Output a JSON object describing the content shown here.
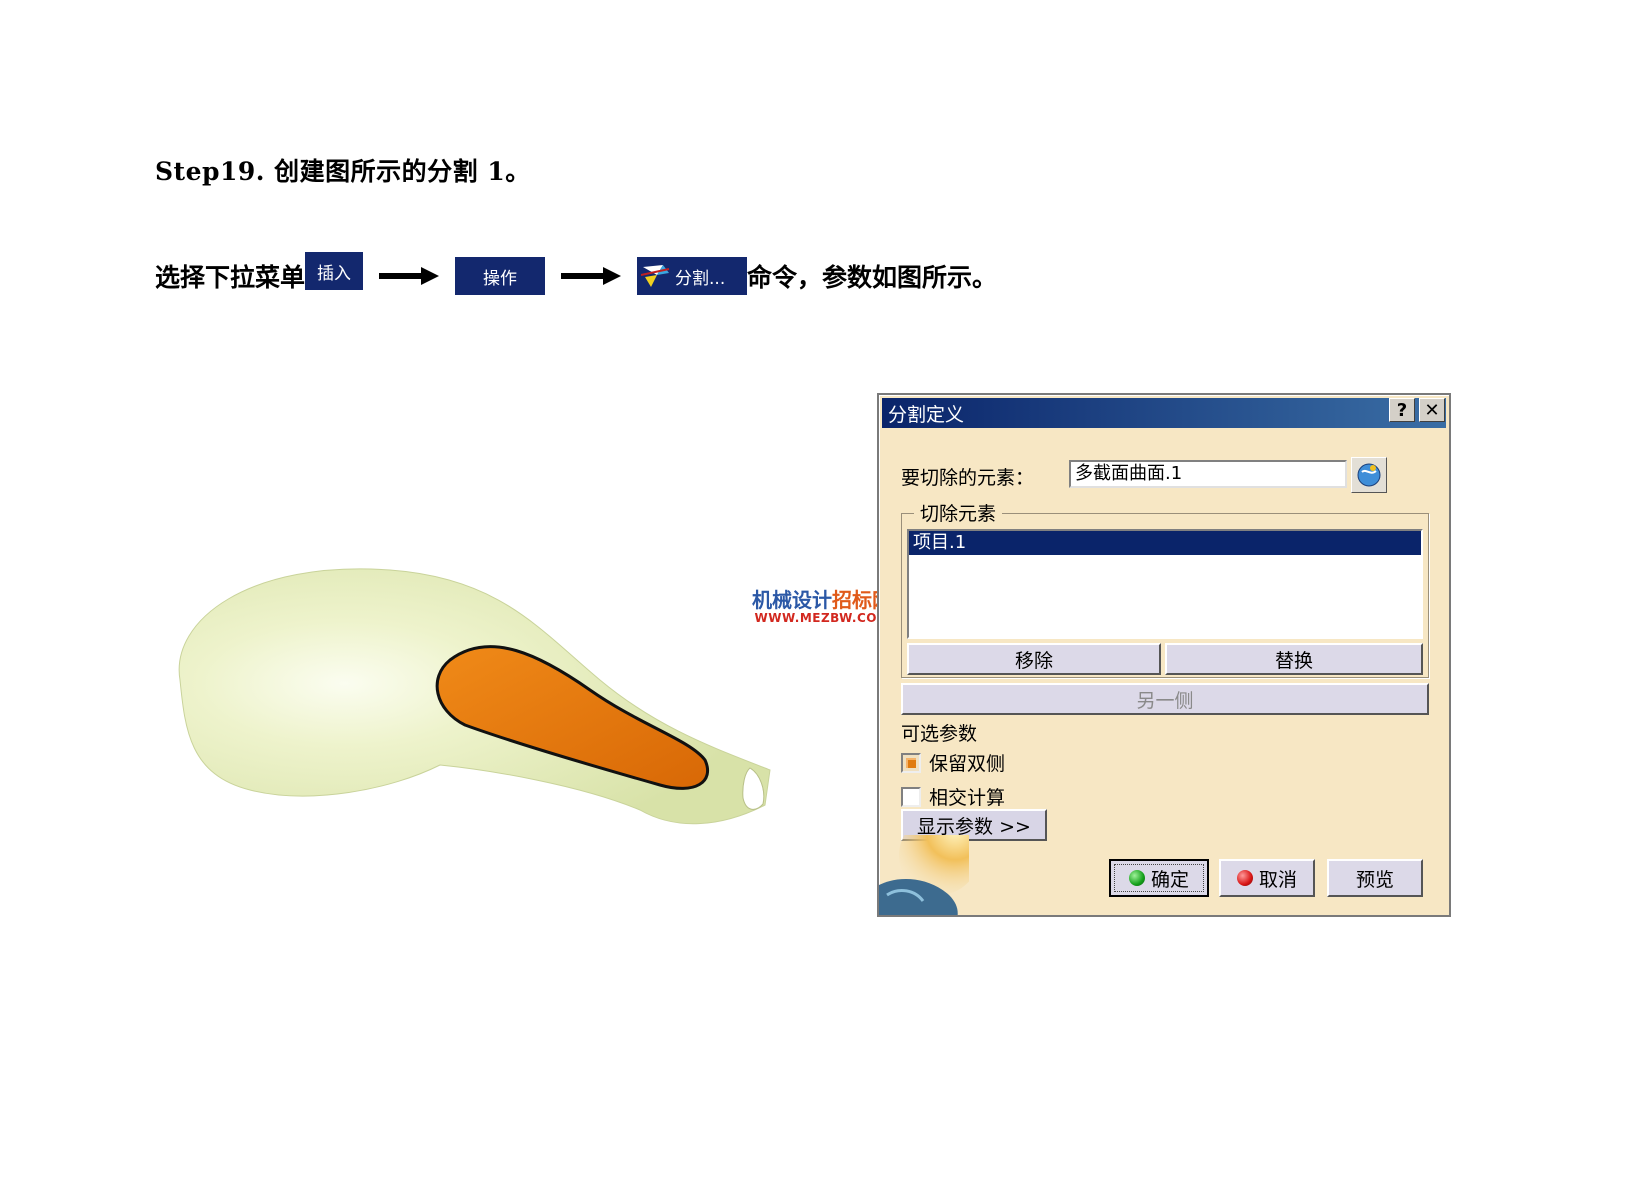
{
  "step": {
    "title": "Step19.  创建图所示的分割 1。"
  },
  "instruction": {
    "prefix": "选择下拉菜单",
    "menu1": "插入",
    "menu2": "操作",
    "menu3": "分割...",
    "suffix": "命令，参数如图所示。"
  },
  "watermark": {
    "line1_a": "机械设计",
    "line1_b": "招标网",
    "line2": "WWW.MEZBW.COM"
  },
  "dialog": {
    "title": "分割定义",
    "help_btn": "?",
    "close_btn": "✕",
    "cut_label": "要切除的元素：",
    "cut_value": "多截面曲面.1",
    "group_title": "切除元素",
    "list_items": [
      "项目.1"
    ],
    "remove_label": "移除",
    "replace_label": "替换",
    "other_side_label": "另一侧",
    "optional_label": "可选参数",
    "keep_both_label": "保留双侧",
    "intersect_label": "相交计算",
    "show_params_label": "显示参数 >>",
    "ok_label": "确定",
    "cancel_label": "取消",
    "preview_label": "预览"
  },
  "checkboxes": {
    "keep_both": true,
    "intersect": false
  },
  "colors": {
    "menu_chip": "#13286e",
    "dialog_bg": "#f7e7c4",
    "surface": "#e9efc4",
    "cut_region": "#e8780c"
  }
}
